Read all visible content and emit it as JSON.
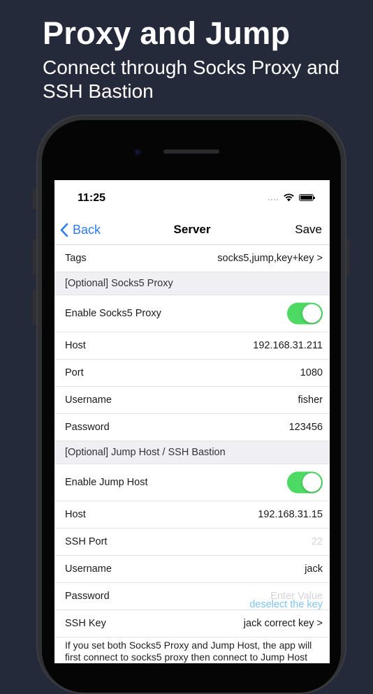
{
  "promo": {
    "title": "Proxy and Jump",
    "subtitle": "Connect through Socks Proxy and SSH Bastion"
  },
  "status_bar": {
    "time": "11:25",
    "icons": [
      "signal-dots-icon",
      "wifi-icon",
      "battery-icon"
    ]
  },
  "nav": {
    "back_label": "Back",
    "title": "Server",
    "save_label": "Save"
  },
  "tags": {
    "label": "Tags",
    "value": "socks5,jump,key+key >"
  },
  "socks5": {
    "header": "[Optional] Socks5 Proxy",
    "enable_label": "Enable Socks5 Proxy",
    "enabled": true,
    "host_label": "Host",
    "host_value": "192.168.31.211",
    "port_label": "Port",
    "port_value": "1080",
    "username_label": "Username",
    "username_value": "fisher",
    "password_label": "Password",
    "password_value": "123456"
  },
  "jump": {
    "header": "[Optional] Jump Host / SSH Bastion",
    "enable_label": "Enable Jump Host",
    "enabled": true,
    "host_label": "Host",
    "host_value": "192.168.31.15",
    "ssh_port_label": "SSH Port",
    "ssh_port_placeholder": "22",
    "username_label": "Username",
    "username_value": "jack",
    "password_label": "Password",
    "password_placeholder": "Enter Value",
    "ssh_key_label": "SSH Key",
    "ssh_key_value": "jack correct key >",
    "deselect_label": "deselect the key"
  },
  "footer_note": "If you set both Socks5 Proxy and Jump Host, the app will first connect to socks5 proxy then connect to Jump Host",
  "colors": {
    "background": "#252a3b",
    "accent": "#2f7cf6",
    "toggle_on": "#4cd964",
    "deselect_link": "#7fc6f2"
  }
}
